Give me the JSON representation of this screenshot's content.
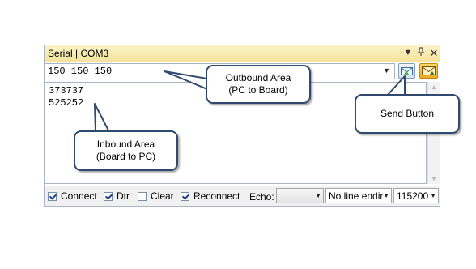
{
  "panel": {
    "title": "Serial | COM3",
    "title_buttons": [
      {
        "name": "dropdown-arrow-icon",
        "glyph": "▼"
      },
      {
        "name": "pin-icon",
        "glyph": "📌"
      },
      {
        "name": "close-icon",
        "glyph": "✕"
      }
    ]
  },
  "outbound": {
    "value": "150 150 150",
    "dropdown_glyph": "▼"
  },
  "inbound": {
    "lines": [
      "373737",
      "525252"
    ]
  },
  "controls": {
    "connect": {
      "label": "Connect",
      "checked": true
    },
    "dtr": {
      "label": "Dtr",
      "checked": true
    },
    "clear": {
      "label": "Clear",
      "checked": false
    },
    "reconnect": {
      "label": "Reconnect",
      "checked": true
    },
    "echo_label": "Echo:",
    "echo_value": "",
    "line_ending_value": "No line endir",
    "baud_value": "115200"
  },
  "callouts": {
    "outbound": [
      "Outbound Area",
      "(PC to Board)"
    ],
    "inbound": [
      "Inbound Area",
      "(Board to PC)"
    ],
    "send": [
      "Send Button"
    ]
  },
  "colors": {
    "titlebar": "#f5e39a",
    "border": "#a9b6c7",
    "callout_border": "#2f4a6e"
  }
}
